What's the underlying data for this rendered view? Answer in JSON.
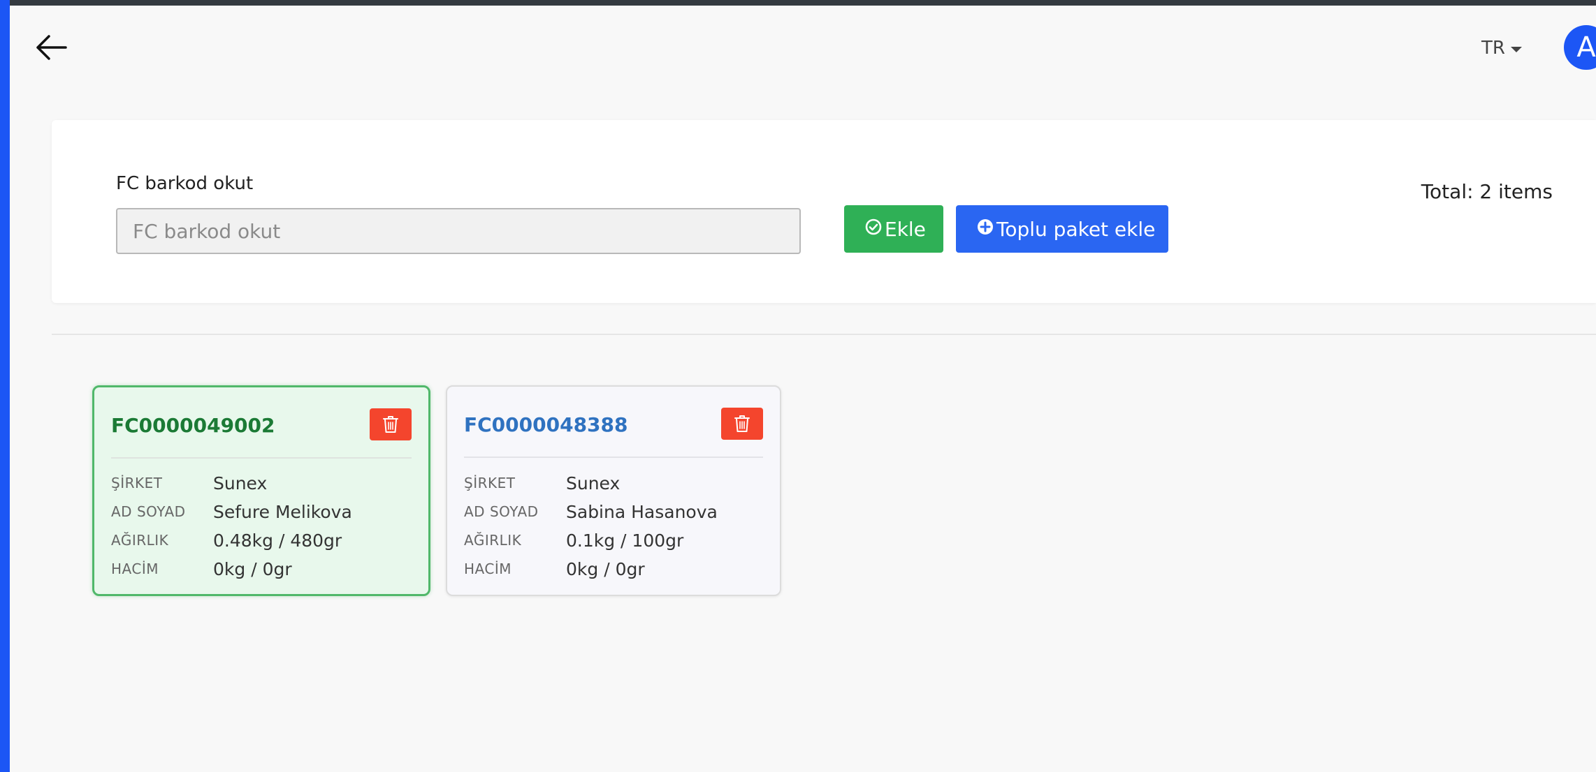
{
  "header": {
    "language": "TR",
    "avatar_initial": "A"
  },
  "form": {
    "label": "FC barkod okut",
    "input_value": "",
    "input_placeholder": "FC barkod okut",
    "add_button": "Ekle",
    "bulk_button": "Toplu paket ekle",
    "total": "Total: 2 items"
  },
  "cards": [
    {
      "code": "FC0000049002",
      "selected": true,
      "fields": [
        {
          "label": "ŞİRKET",
          "value": "Sunex"
        },
        {
          "label": "AD SOYAD",
          "value": "Sefure Melikova"
        },
        {
          "label": "AĞIRLIK",
          "value": "0.48kg / 480gr"
        },
        {
          "label": "HACİM",
          "value": "0kg / 0gr"
        }
      ]
    },
    {
      "code": "FC0000048388",
      "selected": false,
      "fields": [
        {
          "label": "ŞİRKET",
          "value": "Sunex"
        },
        {
          "label": "AD SOYAD",
          "value": "Sabina Hasanova"
        },
        {
          "label": "AĞIRLIK",
          "value": "0.1kg / 100gr"
        },
        {
          "label": "HACİM",
          "value": "0kg / 0gr"
        }
      ]
    }
  ],
  "colors": {
    "accent_blue": "#2a66f2",
    "success_green": "#2fb056",
    "danger_red": "#f4452d",
    "selected_card_bg": "#e8f8ec"
  }
}
